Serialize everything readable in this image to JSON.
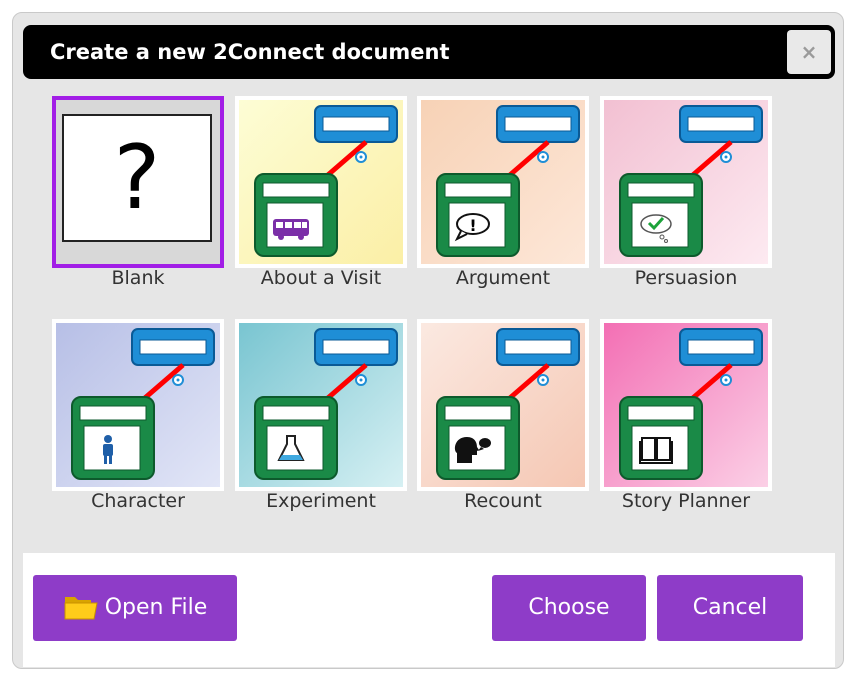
{
  "dialog": {
    "title": "Create a new 2Connect document",
    "close_symbol": "×",
    "templates": [
      {
        "label": "Blank",
        "selected": true,
        "background": [
          "#ffffff",
          "#ffffff"
        ],
        "icon": "question-mark",
        "glyph": "?"
      },
      {
        "label": "About a Visit",
        "selected": false,
        "background": [
          "#fdfdd5",
          "#fbefa6"
        ],
        "icon": "bus-icon"
      },
      {
        "label": "Argument",
        "selected": false,
        "background": [
          "#f7d2b6",
          "#fde7d8"
        ],
        "icon": "speech-bubble-exclamation-icon"
      },
      {
        "label": "Persuasion",
        "selected": false,
        "background": [
          "#f2c0d2",
          "#fdeaf1"
        ],
        "icon": "thought-cloud-check-icon"
      },
      {
        "label": "Character",
        "selected": false,
        "background": [
          "#b7bfe6",
          "#e2e6f7"
        ],
        "icon": "person-icon"
      },
      {
        "label": "Experiment",
        "selected": false,
        "background": [
          "#79c5d1",
          "#d6f0f3"
        ],
        "icon": "flask-icon"
      },
      {
        "label": "Recount",
        "selected": false,
        "background": [
          "#fbe9e1",
          "#f5c7b3"
        ],
        "icon": "speaking-head-icon"
      },
      {
        "label": "Story Planner",
        "selected": false,
        "background": [
          "#f36fb4",
          "#fbd0e6"
        ],
        "icon": "open-book-icon"
      }
    ]
  },
  "footer": {
    "open_file_label": "Open File",
    "choose_label": "Choose",
    "cancel_label": "Cancel"
  },
  "colors": {
    "button": "#8e3cc8",
    "selection": "#a21ee6",
    "node_green": "#1a8a47",
    "node_blue": "#1f8ed6",
    "connector": "#ff0000"
  }
}
